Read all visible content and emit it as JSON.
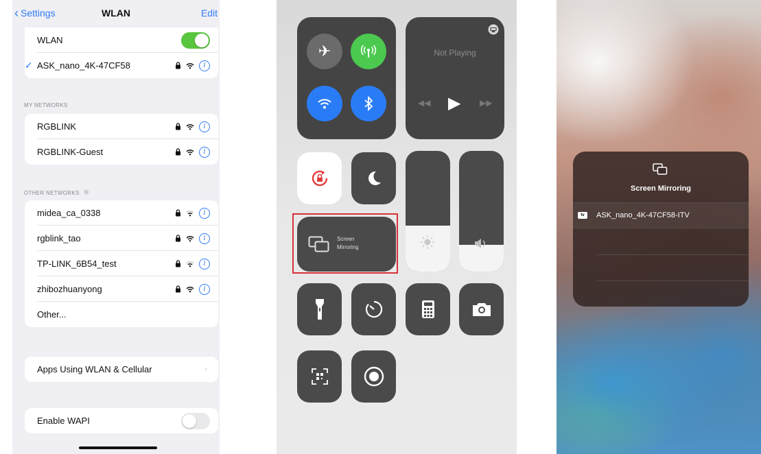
{
  "wlan": {
    "nav": {
      "back_label": "Settings",
      "title": "WLAN",
      "edit_label": "Edit"
    },
    "toggle_label": "WLAN",
    "toggle_on": true,
    "connected_network": "ASK_nano_4K-47CF58",
    "my_networks_header": "MY NETWORKS",
    "my_networks": [
      {
        "name": "RGBLINK"
      },
      {
        "name": "RGBLINK-Guest"
      }
    ],
    "other_networks_header": "OTHER NETWORKS",
    "other_networks": [
      {
        "name": "midea_ca_0338"
      },
      {
        "name": "rgblink_tao"
      },
      {
        "name": "TP-LINK_6B54_test"
      },
      {
        "name": "zhibozhuanyong"
      }
    ],
    "other_label": "Other...",
    "apps_label": "Apps Using WLAN & Cellular",
    "wapi_label": "Enable WAPI",
    "wapi_on": false,
    "colors": {
      "accent": "#2f7bf5",
      "toggle_on": "#5ac63f"
    }
  },
  "control_center": {
    "now_playing": "Not Playing",
    "screen_mirroring_line1": "Screen",
    "screen_mirroring_line2": "Mirroring",
    "brightness_level": 0.38,
    "volume_level": 0.22,
    "icons": [
      "airplane-icon",
      "cellular-icon",
      "wifi-icon",
      "bluetooth-icon",
      "airplay-icon",
      "rotation-lock-icon",
      "moon-icon",
      "screen-mirroring-icon",
      "brightness-icon",
      "volume-icon",
      "flashlight-icon",
      "timer-icon",
      "calculator-icon",
      "camera-icon",
      "qr-scanner-icon",
      "screen-record-icon"
    ],
    "colors": {
      "cellular": "#4cc94f",
      "wifi": "#2a7cf6",
      "bluetooth": "#2a7cf6",
      "highlight": "#d8303a"
    }
  },
  "screen_mirroring": {
    "title": "Screen Mirroring",
    "device_badge": "tv",
    "device_name": "ASK_nano_4K-47CF58-ITV"
  }
}
